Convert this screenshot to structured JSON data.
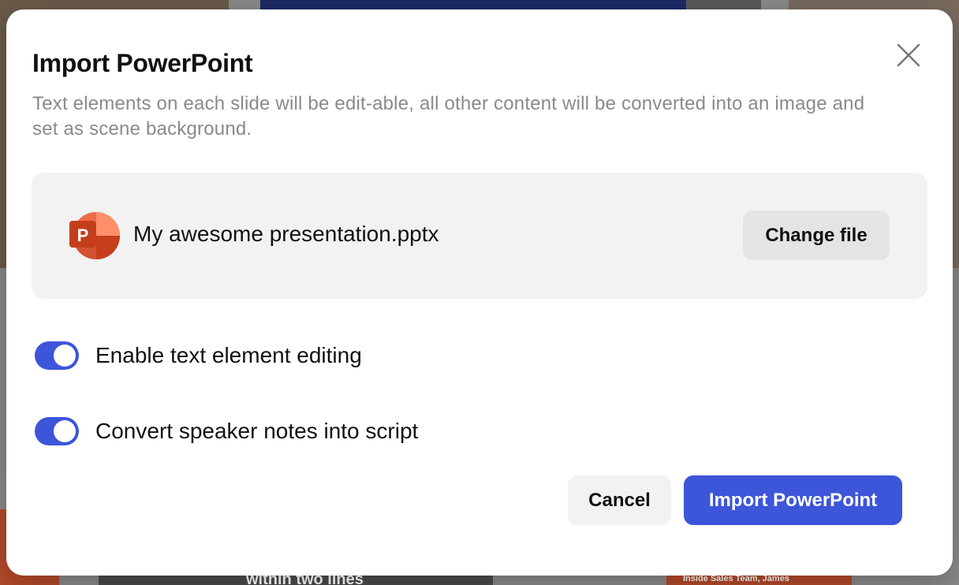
{
  "background": {
    "text_fragments": [
      "within two lines",
      "Inside Sales Team, James"
    ]
  },
  "dialog": {
    "title": "Import PowerPoint",
    "description": "Text elements on each slide will be edit-able, all other content will be converted into an image and set as scene background.",
    "close_icon": "close-icon",
    "file": {
      "icon": "powerpoint-icon",
      "icon_letter": "P",
      "name": "My awesome presentation.pptx",
      "change_label": "Change file"
    },
    "options": [
      {
        "label": "Enable text element editing",
        "enabled": true
      },
      {
        "label": "Convert speaker notes into script",
        "enabled": true
      }
    ],
    "cancel_label": "Cancel",
    "confirm_label": "Import PowerPoint"
  },
  "colors": {
    "accent": "#3D55D9",
    "panel": "#F2F2F2",
    "secondary_button": "#E4E4E6",
    "muted_text": "#8A8A8A",
    "powerpoint_red": "#C43E1C"
  }
}
